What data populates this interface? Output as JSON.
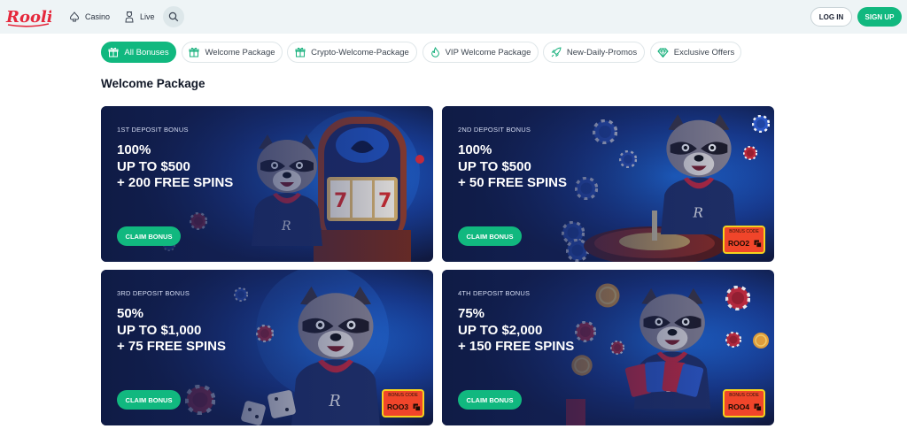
{
  "header": {
    "logo_text": "Rooli",
    "nav": [
      {
        "label": "Casino",
        "icon": "spade-icon"
      },
      {
        "label": "Live",
        "icon": "dealer-icon"
      }
    ],
    "search_icon": "search-icon",
    "login_label": "LOG IN",
    "signup_label": "SIGN UP"
  },
  "filters": [
    {
      "label": "All Bonuses",
      "icon": "gift-icon",
      "active": true
    },
    {
      "label": "Welcome Package",
      "icon": "gift-icon",
      "active": false
    },
    {
      "label": "Crypto-Welcome-Package",
      "icon": "gift-icon",
      "active": false
    },
    {
      "label": "VIP Welcome Package",
      "icon": "flame-icon",
      "active": false
    },
    {
      "label": "New-Daily-Promos",
      "icon": "rocket-icon",
      "active": false
    },
    {
      "label": "Exclusive Offers",
      "icon": "diamond-icon",
      "active": false
    }
  ],
  "section_title": "Welcome Package",
  "cards": [
    {
      "label": "1ST DEPOSIT BONUS",
      "line1": "100%",
      "line2": "UP TO $500",
      "line3": "+ 200 FREE SPINS",
      "button": "CLAIM BONUS",
      "art": "raccoon-slot-machine-illustration"
    },
    {
      "label": "2ND DEPOSIT BONUS",
      "line1": "100%",
      "line2": "UP TO $500",
      "line3": "+ 50 FREE SPINS",
      "button": "CLAIM BONUS",
      "code_label": "BONUS CODE",
      "code": "ROO2",
      "art": "raccoon-roulette-illustration"
    },
    {
      "label": "3RD DEPOSIT BONUS",
      "line1": "50%",
      "line2": "UP TO $1,000",
      "line3": "+ 75 FREE SPINS",
      "button": "CLAIM BONUS",
      "code_label": "BONUS CODE",
      "code": "ROO3",
      "art": "raccoon-dice-illustration"
    },
    {
      "label": "4TH DEPOSIT BONUS",
      "line1": "75%",
      "line2": "UP TO $2,000",
      "line3": "+ 150 FREE SPINS",
      "button": "CLAIM BONUS",
      "code_label": "BONUS CODE",
      "code": "ROO4",
      "art": "raccoon-cards-illustration"
    }
  ],
  "colors": {
    "accent": "#11b87f",
    "header_bg": "#eef4f6",
    "card_bg": "#142259",
    "brand_red": "#e5283c",
    "code_badge": "#f0452a",
    "code_border": "#f5d21e"
  }
}
